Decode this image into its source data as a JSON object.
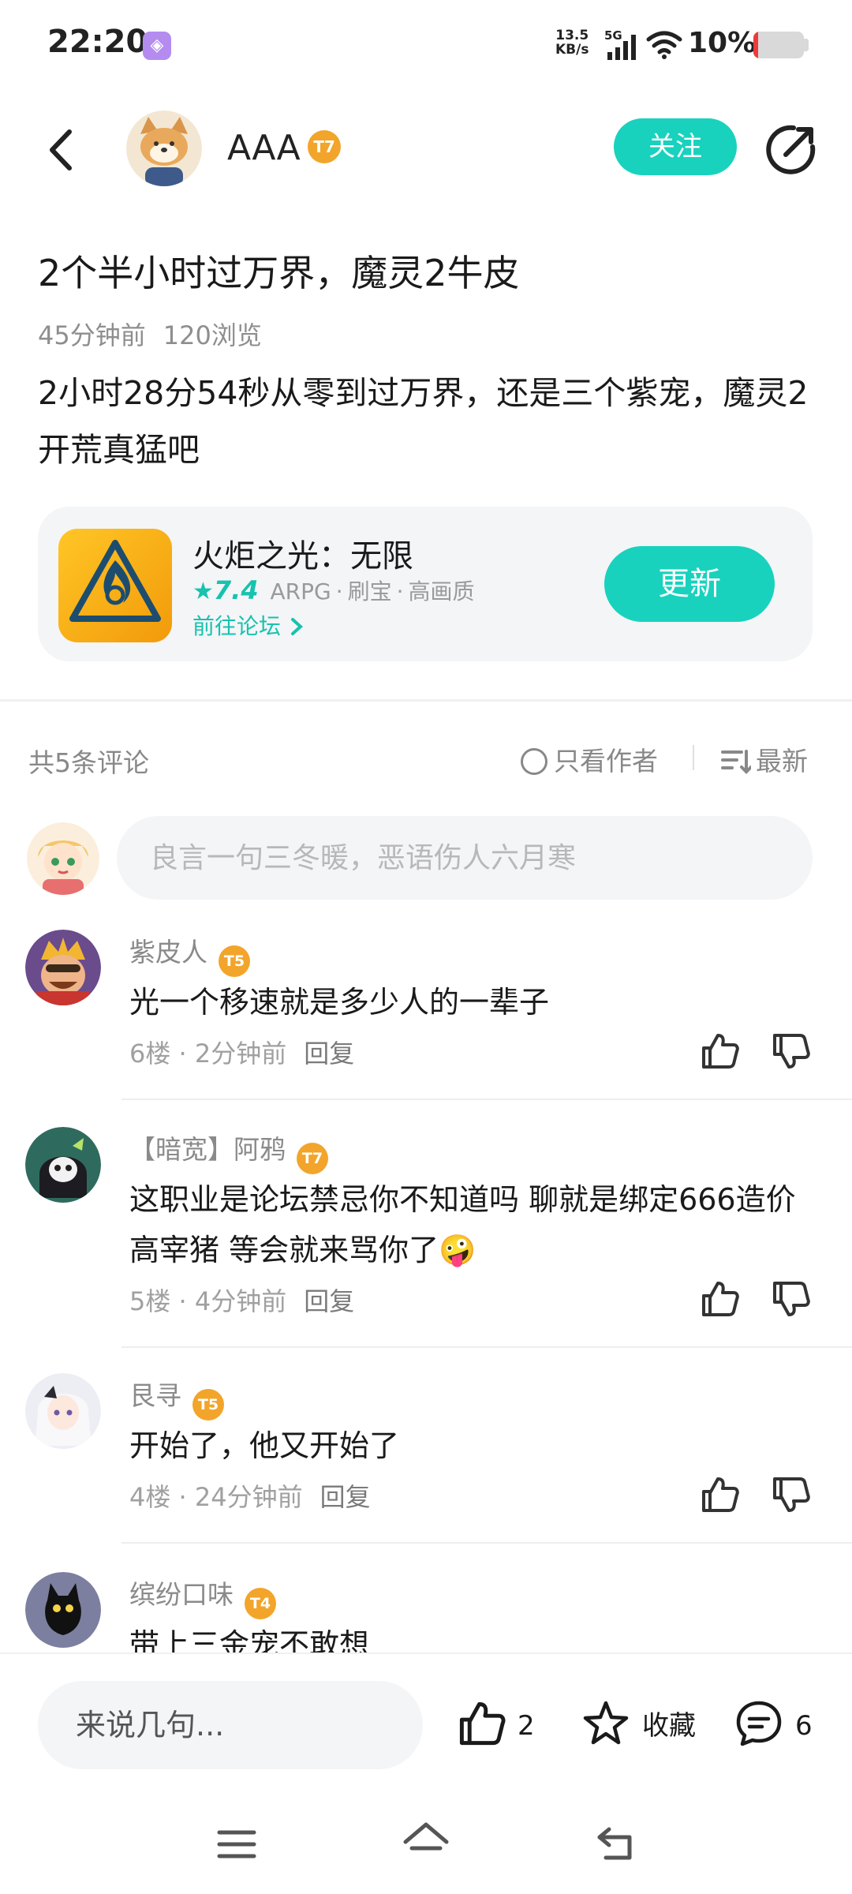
{
  "status_bar": {
    "time": "22:20",
    "net_speed_value": "13.5",
    "net_speed_unit": "KB/s",
    "network": "5G",
    "battery_text": "10%",
    "battery_level": 0.1,
    "battery_color": "#ee3a3a"
  },
  "header": {
    "author_name": "AAA",
    "author_level": "7",
    "follow_label": "关注"
  },
  "post": {
    "title": "2个半小时过万界，魔灵2牛皮",
    "time_ago": "45分钟前",
    "views": "120浏览",
    "body": "2小时28分54秒从零到过万界，还是三个紫宠，魔灵2开荒真猛吧"
  },
  "game_card": {
    "name": "火炬之光：无限",
    "rating": "7.4",
    "tags": [
      "ARPG",
      "·",
      "刷宝",
      "·",
      "高画质"
    ],
    "forum_link": "前往论坛",
    "update_label": "更新"
  },
  "comments_header": {
    "count_label": "共5条评论",
    "author_only_label": "只看作者",
    "sort_label": "最新"
  },
  "comment_input": {
    "placeholder": "良言一句三冬暖，恶语伤人六月寒"
  },
  "comments": [
    {
      "name": "紫皮人",
      "level": "5",
      "text": "光一个移速就是多少人的一辈子",
      "floor": "6楼",
      "sep": "·",
      "time": "2分钟前",
      "reply": "回复"
    },
    {
      "name": "【暗宽】阿鸦",
      "level": "7",
      "text": "这职业是论坛禁忌你不知道吗 聊就是绑定666造价高宰猪 等会就来骂你了",
      "emoji": "🤪",
      "floor": "5楼",
      "sep": "·",
      "time": "4分钟前",
      "reply": "回复"
    },
    {
      "name": "艮寻",
      "level": "5",
      "text": "开始了，他又开始了",
      "floor": "4楼",
      "sep": "·",
      "time": "24分钟前",
      "reply": "回复"
    },
    {
      "name": "缤纷口味",
      "level": "4",
      "text": "带上三金宠不敢想"
    }
  ],
  "bottom_bar": {
    "input_placeholder": "来说几句...",
    "like_count": "2",
    "favorite_label": "收藏",
    "comment_count": "6"
  },
  "colors": {
    "accent": "#18d2be",
    "badge": "#f2a52a"
  },
  "icons": [
    "back-arrow-icon",
    "share-icon",
    "star-icon",
    "chevron-right-icon",
    "radio-icon",
    "sort-icon",
    "thumb-up-icon",
    "thumb-down-icon",
    "star-outline-icon",
    "chat-bubble-icon",
    "menu-icon",
    "home-icon",
    "back-nav-icon"
  ]
}
